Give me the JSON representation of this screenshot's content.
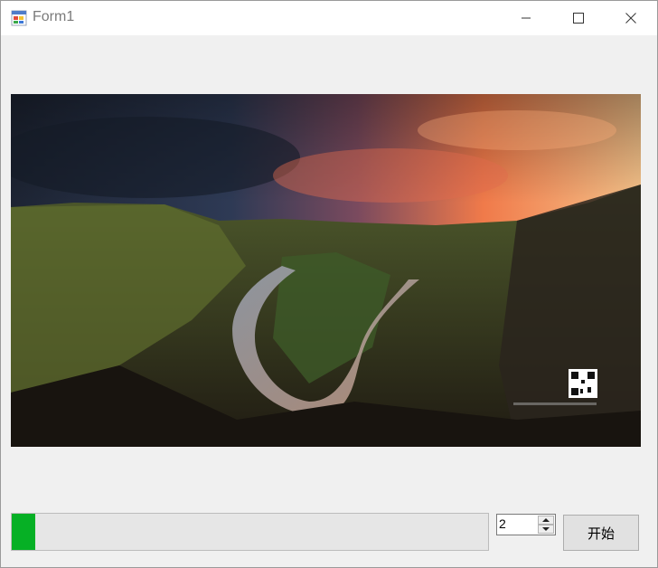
{
  "window": {
    "title": "Form1",
    "icon": "windows-form-icon",
    "controls": {
      "minimize": "minimize-icon",
      "maximize": "maximize-icon",
      "close": "close-icon"
    }
  },
  "picture": {
    "content": "landscape-photo",
    "qr_code": "qr-code-icon"
  },
  "progress": {
    "value_percent": 5,
    "fill_color": "#06b025"
  },
  "numeric_updown": {
    "value": "2"
  },
  "start_button": {
    "label": "开始"
  }
}
